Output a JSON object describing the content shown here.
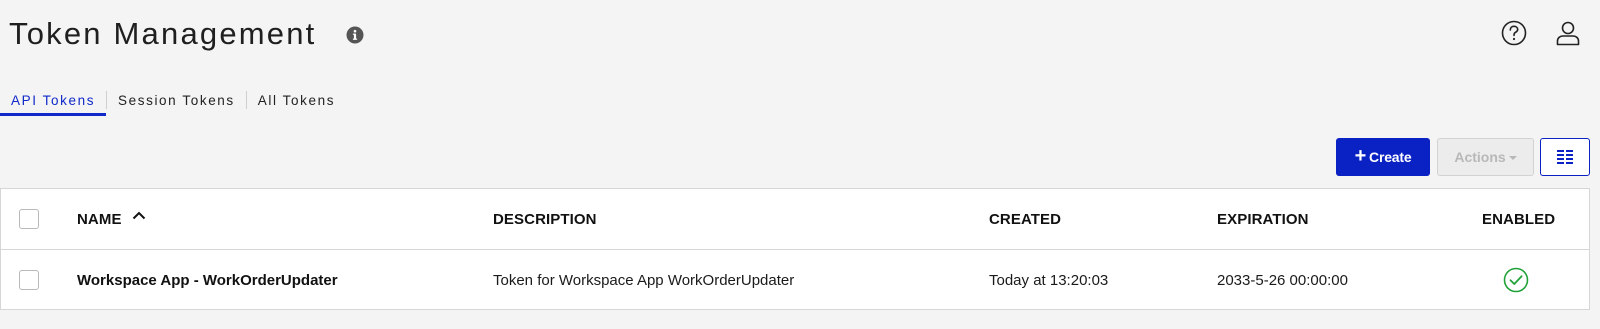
{
  "header": {
    "title": "Token Management",
    "info_icon": "info-icon",
    "help_icon": "question-circle-icon",
    "user_icon": "user-icon"
  },
  "tabs": [
    {
      "label": "API Tokens",
      "active": true
    },
    {
      "label": "Session Tokens",
      "active": false
    },
    {
      "label": "All Tokens",
      "active": false
    }
  ],
  "toolbar": {
    "create_label": "Create",
    "create_icon": "+",
    "actions_label": "Actions",
    "actions_enabled": false,
    "columns_icon": "column-chooser-icon"
  },
  "table": {
    "columns": {
      "name": "NAME",
      "description": "DESCRIPTION",
      "created": "CREATED",
      "expiration": "EXPIRATION",
      "enabled": "ENABLED"
    },
    "sort": {
      "column": "NAME",
      "direction": "ascending"
    },
    "rows": [
      {
        "name": "Workspace App - WorkOrderUpdater",
        "description": "Token for Workspace App WorkOrderUpdater",
        "created": "Today at 13:20:03",
        "expiration": "2033-5-26 00:00:00",
        "enabled": true
      }
    ]
  },
  "colors": {
    "accent": "#0a21c4",
    "background": "#f4f4f4",
    "enabled_check": "#22a33a",
    "disabled_button": "#ececec"
  }
}
